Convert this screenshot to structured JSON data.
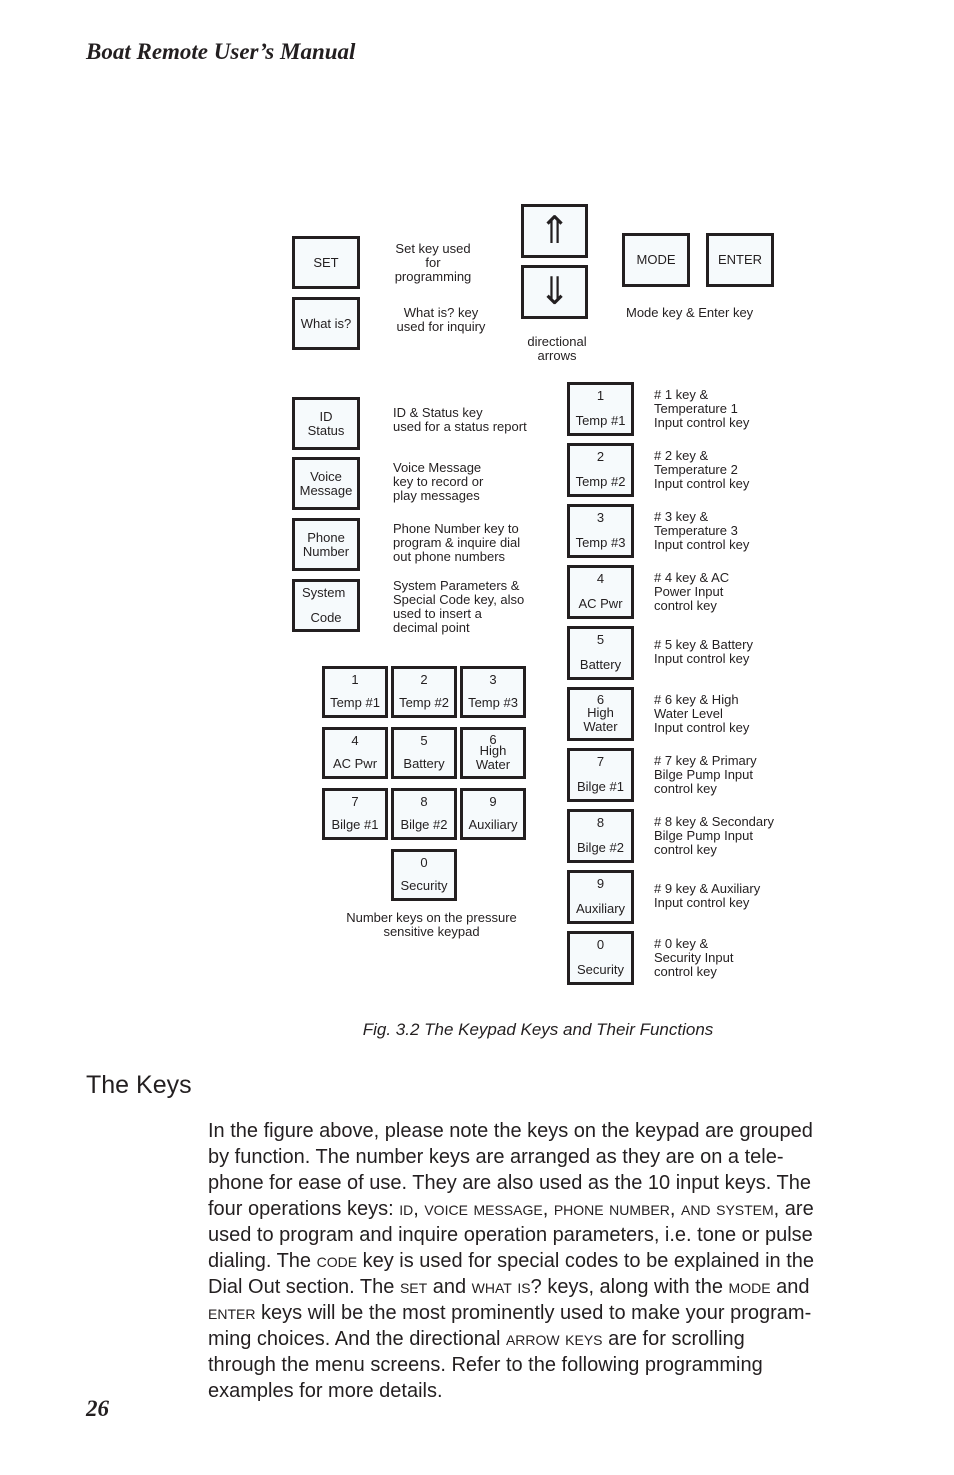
{
  "header": {
    "running_head": "Boat Remote User’s Manual"
  },
  "figure": {
    "top_keys": {
      "set": {
        "label": "SET",
        "desc": "Set key used\nfor\nprogramming"
      },
      "what_is": {
        "label": "What is?",
        "desc": "What is? key\nused for inquiry"
      },
      "arrow_up": {
        "icon": "double-arrow-up-icon",
        "glyph": "⇑"
      },
      "arrow_down": {
        "icon": "double-arrow-down-icon",
        "glyph": "⇓"
      },
      "arrows_desc": "directional\narrows",
      "mode": {
        "label": "MODE"
      },
      "enter": {
        "label": "ENTER"
      },
      "mode_enter_desc": "Mode key & Enter key"
    },
    "function_keys": [
      {
        "line1": "ID",
        "line2": "Status",
        "desc": "ID & Status key\nused for a status report"
      },
      {
        "line1": "Voice",
        "line2": "Message",
        "desc": "Voice Message\nkey to record or\nplay messages"
      },
      {
        "line1": "Phone",
        "line2": "Number",
        "desc": "Phone Number key to\nprogram & inquire dial\nout phone numbers"
      },
      {
        "line1": "System",
        "line2": "Code",
        "desc": "System Parameters &\nSpecial Code key, also\nused to insert  a\ndecimal point"
      }
    ],
    "keypad": {
      "keys": [
        {
          "num": "1",
          "label": "Temp #1"
        },
        {
          "num": "2",
          "label": "Temp #2"
        },
        {
          "num": "3",
          "label": "Temp #3"
        },
        {
          "num": "4",
          "label": "AC  Pwr"
        },
        {
          "num": "5",
          "label": "Battery"
        },
        {
          "num": "6",
          "label": "High\nWater"
        },
        {
          "num": "7",
          "label": "Bilge #1"
        },
        {
          "num": "8",
          "label": "Bilge #2"
        },
        {
          "num": "9",
          "label": "Auxiliary"
        },
        {
          "num": "0",
          "label": "Security"
        }
      ],
      "caption": "Number keys on the pressure\nsensitive keypad"
    },
    "number_key_list": [
      {
        "num": "1",
        "label": "Temp #1",
        "desc": "# 1 key &\nTemperature 1\nInput control key"
      },
      {
        "num": "2",
        "label": "Temp #2",
        "desc": "# 2 key &\nTemperature 2\nInput control key"
      },
      {
        "num": "3",
        "label": "Temp #3",
        "desc": "# 3 key &\nTemperature 3\nInput control key"
      },
      {
        "num": "4",
        "label": "AC  Pwr",
        "desc": "# 4 key & AC\nPower Input\ncontrol key"
      },
      {
        "num": "5",
        "label": "Battery",
        "desc": "# 5 key & Battery\nInput control key"
      },
      {
        "num": "6",
        "label": "High\nWater",
        "desc": "# 6 key & High\nWater Level\nInput control key"
      },
      {
        "num": "7",
        "label": "Bilge #1",
        "desc": "# 7 key & Primary\nBilge Pump Input\ncontrol key"
      },
      {
        "num": "8",
        "label": "Bilge #2",
        "desc": "# 8 key & Secondary\nBilge Pump Input\ncontrol key"
      },
      {
        "num": "9",
        "label": "Auxiliary",
        "desc": "# 9 key & Auxiliary\nInput control key"
      },
      {
        "num": "0",
        "label": "Security",
        "desc": "# 0 key &\nSecurity Input\ncontrol key"
      }
    ],
    "caption": "Fig. 3.2 The Keypad Keys and Their Functions"
  },
  "section": {
    "title": "The Keys",
    "lines": [
      [
        {
          "t": "In the figure above, please note the keys on the keypad are grouped"
        }
      ],
      [
        {
          "t": "by function. The number keys are arranged as they are on a tele-"
        }
      ],
      [
        {
          "t": "phone for ease of use. They are also used as the 10 input keys. The"
        }
      ],
      [
        {
          "t": "four operations keys: "
        },
        {
          "t": "ID",
          "sc": true
        },
        {
          "t": ", "
        },
        {
          "t": "VOICE MESSAGE",
          "sc": true
        },
        {
          "t": ", "
        },
        {
          "t": "PHONE NUMBER",
          "sc": true
        },
        {
          "t": ", "
        },
        {
          "t": "AND SYSTEM",
          "sc": true
        },
        {
          "t": ", are"
        }
      ],
      [
        {
          "t": "used to program and inquire operation parameters, i.e. tone or pulse"
        }
      ],
      [
        {
          "t": "dialing. The "
        },
        {
          "t": "CODE",
          "sc": true
        },
        {
          "t": " key is used for special codes to be explained in the"
        }
      ],
      [
        {
          "t": "Dial Out section. The "
        },
        {
          "t": "SET",
          "sc": true
        },
        {
          "t": " and "
        },
        {
          "t": "WHAT IS",
          "sc": true
        },
        {
          "t": "? keys, along with the "
        },
        {
          "t": "MODE",
          "sc": true
        },
        {
          "t": " and"
        }
      ],
      [
        {
          "t": "ENTER",
          "sc": true
        },
        {
          "t": " keys will be the most prominently used to make your program-"
        }
      ],
      [
        {
          "t": "ming choices. And the directional "
        },
        {
          "t": "ARROW KEYS",
          "sc": true
        },
        {
          "t": " are for scrolling"
        }
      ],
      [
        {
          "t": "through the menu screens. Refer to the following programming"
        }
      ],
      [
        {
          "t": "examples for more details."
        }
      ]
    ]
  },
  "footer": {
    "page_number": "26"
  }
}
